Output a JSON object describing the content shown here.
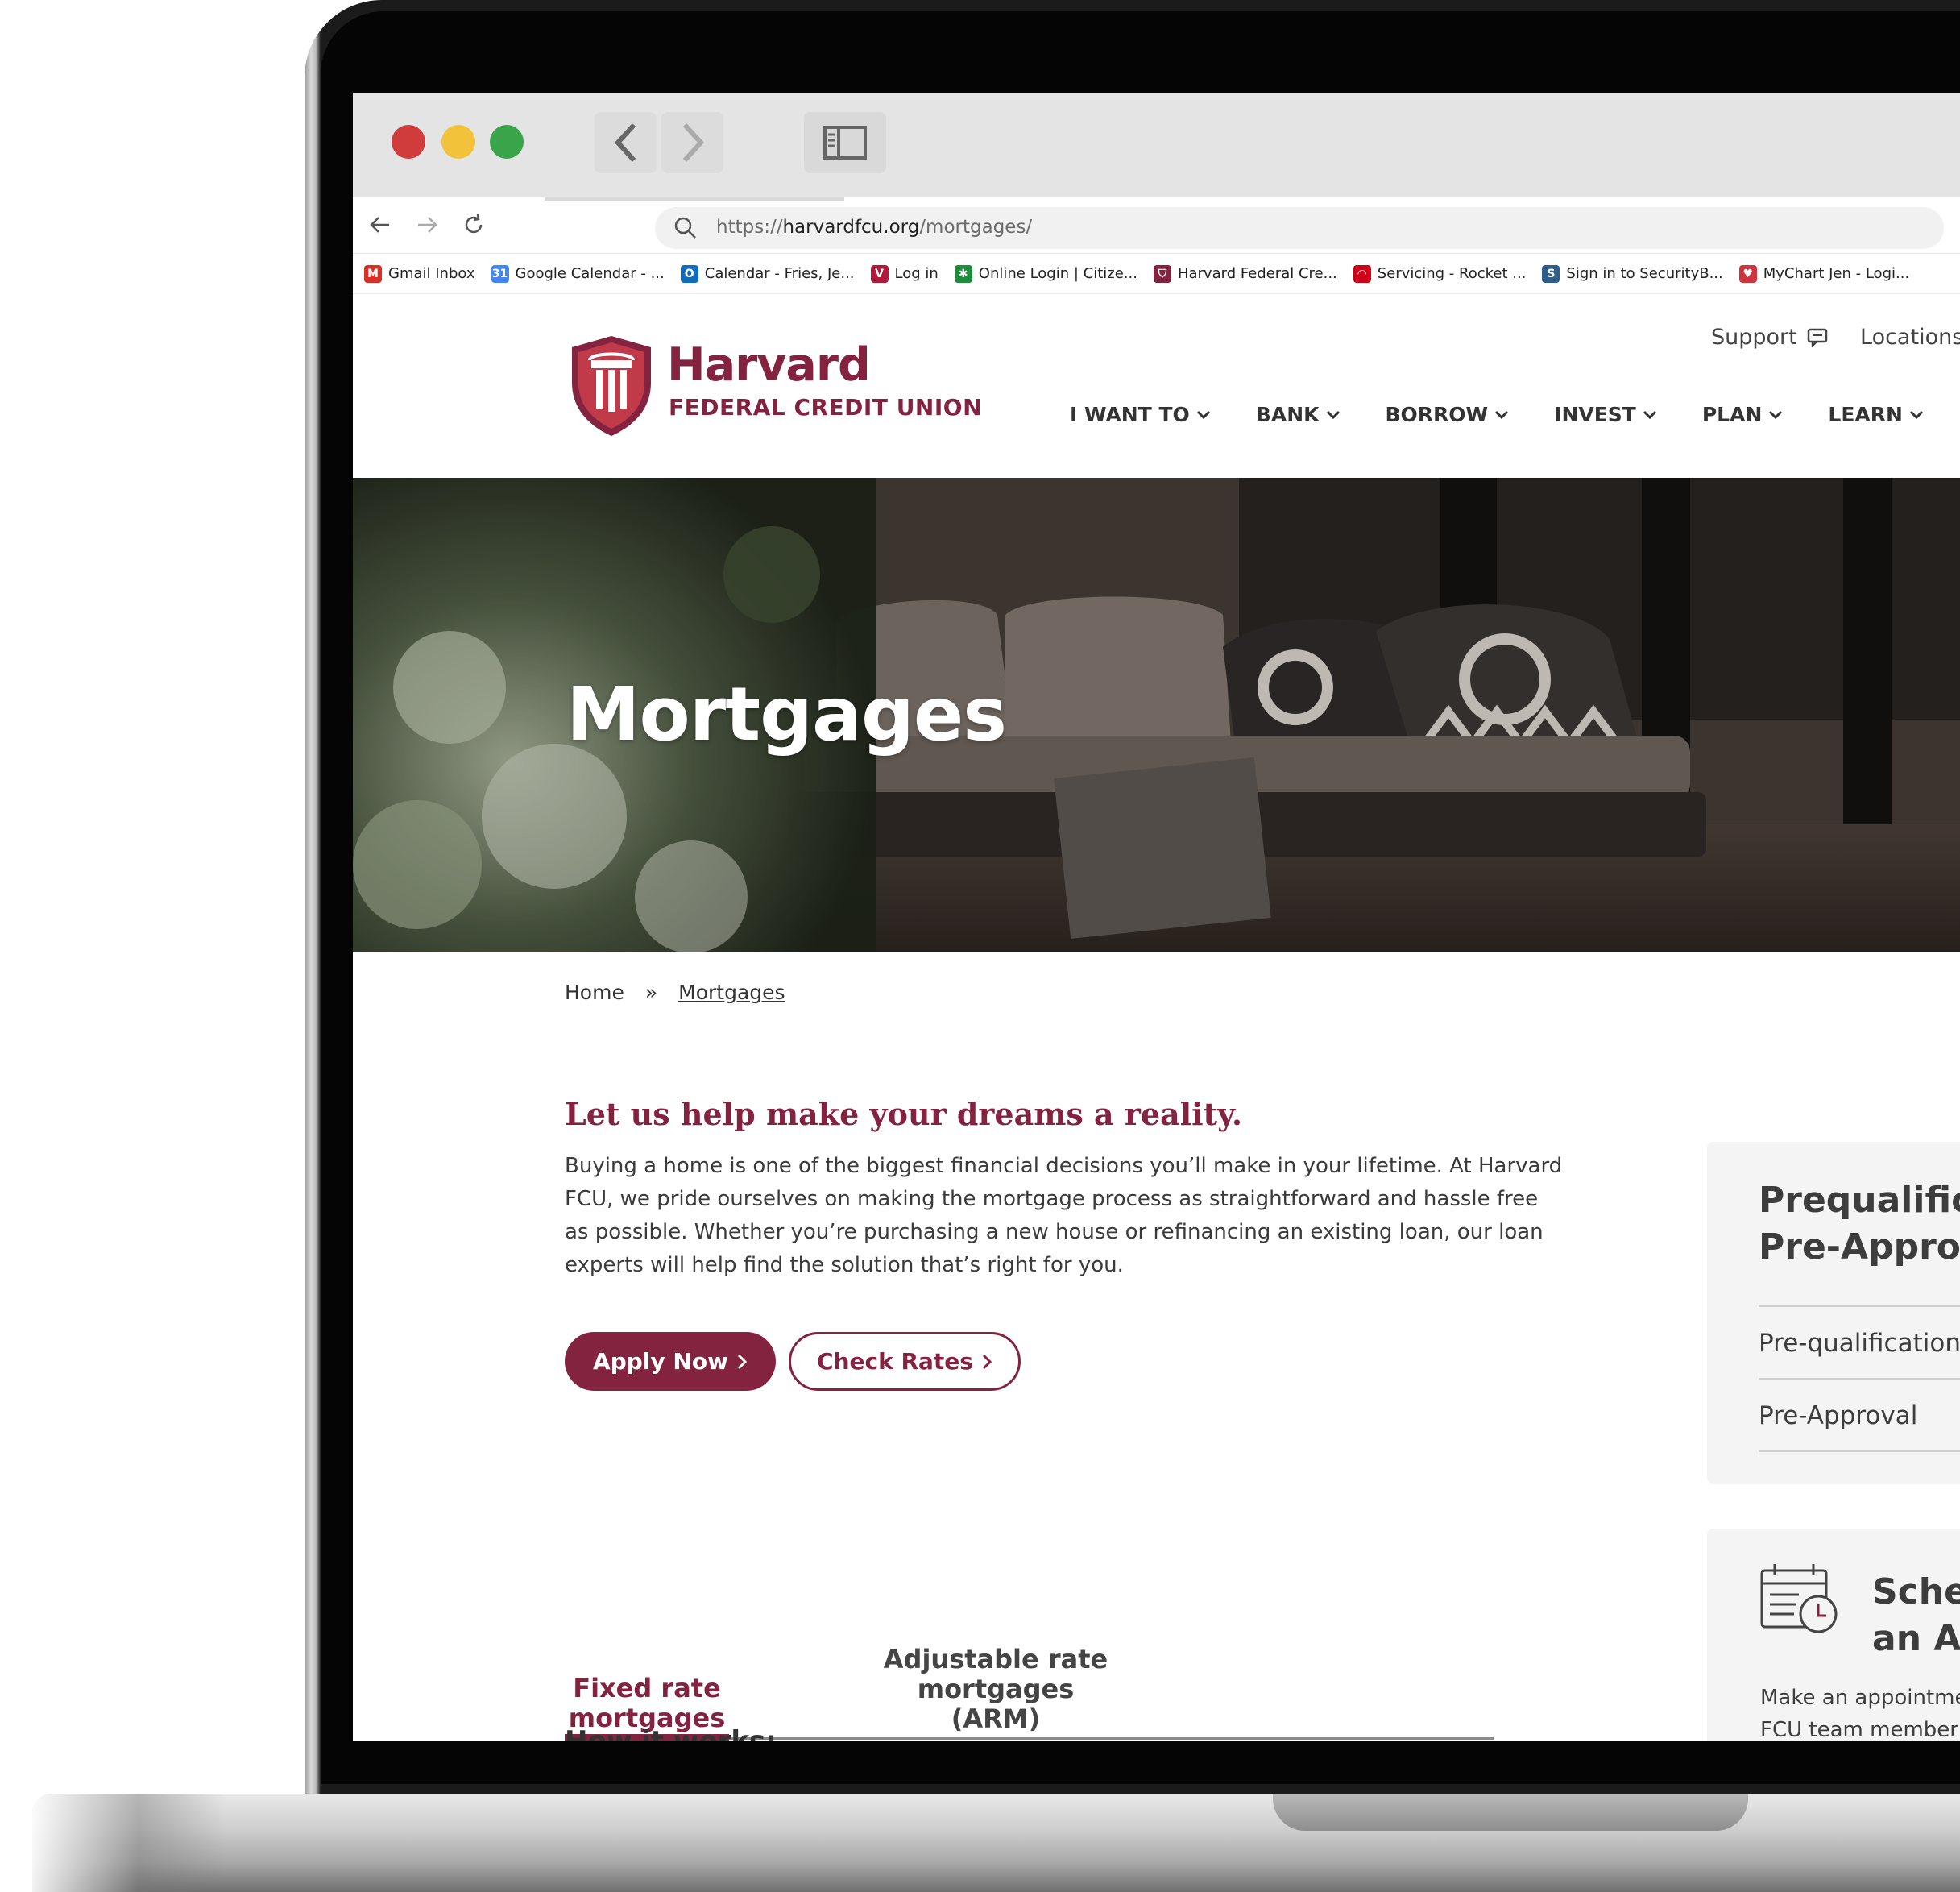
{
  "browser": {
    "url_prefix": "https://",
    "url_host": "harvardfcu.org",
    "url_path": "/mortgages/",
    "bookmarks": [
      {
        "label": "Gmail Inbox",
        "icon": "gmail-icon",
        "color": "#d93025",
        "glyph": "M"
      },
      {
        "label": "Google Calendar - ...",
        "icon": "google-calendar-icon",
        "color": "#4285f4",
        "glyph": "31"
      },
      {
        "label": "Calendar - Fries, Je...",
        "icon": "outlook-icon",
        "color": "#0f6cbd",
        "glyph": "O"
      },
      {
        "label": "Log in",
        "icon": "v-logo-icon",
        "color": "#b0193a",
        "glyph": "V"
      },
      {
        "label": "Online Login | Citize...",
        "icon": "citizens-icon",
        "color": "#1e8e3e",
        "glyph": "✱"
      },
      {
        "label": "Harvard Federal Cre...",
        "icon": "harvard-shield-icon",
        "color": "#83233f",
        "glyph": "⛉"
      },
      {
        "label": "Servicing - Rocket ...",
        "icon": "rocket-icon",
        "color": "#d0021b",
        "glyph": "◠"
      },
      {
        "label": "Sign in to SecurityB...",
        "icon": "securityb-icon",
        "color": "#2f5d8a",
        "glyph": "S"
      },
      {
        "label": "MyChart Jen - Logi...",
        "icon": "mychart-icon",
        "color": "#d0343e",
        "glyph": "♥"
      }
    ]
  },
  "header": {
    "logo_name": "Harvard",
    "logo_sub": "FEDERAL CREDIT UNION",
    "support_label": "Support",
    "locations_label": "Locations",
    "nav": [
      "I WANT TO",
      "BANK",
      "BORROW",
      "INVEST",
      "PLAN",
      "LEARN"
    ]
  },
  "hero": {
    "title": "Mortgages"
  },
  "breadcrumb": {
    "home": "Home",
    "separator": "»",
    "current": "Mortgages"
  },
  "intro": {
    "heading": "Let us help make your dreams a reality.",
    "body": "Buying a home is one of the biggest financial decisions you’ll make in your lifetime. At Harvard FCU, we pride ourselves on making the mortgage process as straightforward and hassle free as possible. Whether you’re purchasing a new house or refinancing an existing loan, our loan experts will help find the solution that’s right for you.",
    "apply_label": "Apply Now",
    "rates_label": "Check Rates"
  },
  "tabs": {
    "fixed_line1": "Fixed rate",
    "fixed_line2": "mortgages",
    "arm_line1": "Adjustable rate",
    "arm_line2": "mortgages",
    "arm_line3": "(ARM)",
    "section_heading": "How it works:"
  },
  "sidebar": {
    "prequal_title_line1": "Prequalifica",
    "prequal_title_line2": "Pre-Approv",
    "link_prequal": "Pre-qualification",
    "link_preapproval": "Pre-Approval",
    "sched_title_line1": "Sche",
    "sched_title_line2": "an Ap",
    "sched_body_line1": "Make an appointme",
    "sched_body_line2": "FCU team member"
  },
  "colors": {
    "brand": "#83233f",
    "text": "#3b3b3b"
  }
}
